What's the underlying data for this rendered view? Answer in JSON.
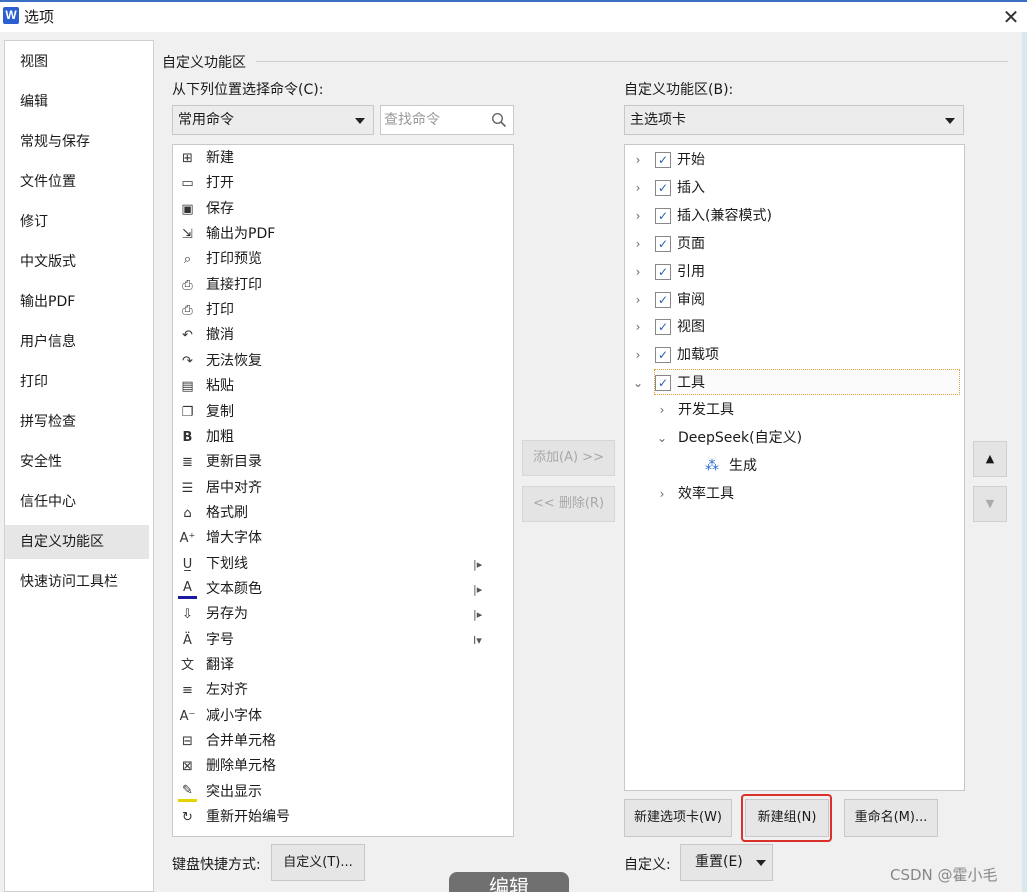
{
  "window": {
    "logo": "W",
    "title": "选项",
    "close": "✕"
  },
  "nav": {
    "items": [
      "视图",
      "编辑",
      "常规与保存",
      "文件位置",
      "修订",
      "中文版式",
      "输出PDF",
      "用户信息",
      "打印",
      "拼写检查",
      "安全性",
      "信任中心",
      "自定义功能区",
      "快速访问工具栏"
    ],
    "active_index": 12
  },
  "section_title": "自定义功能区",
  "left": {
    "label": "从下列位置选择命令(C):",
    "combo_value": "常用命令",
    "search_placeholder": "查找命令",
    "commands": [
      {
        "icon": "new-icon",
        "label": "新建"
      },
      {
        "icon": "open-icon",
        "label": "打开"
      },
      {
        "icon": "save-icon",
        "label": "保存"
      },
      {
        "icon": "export-pdf-icon",
        "label": "输出为PDF"
      },
      {
        "icon": "print-preview-icon",
        "label": "打印预览"
      },
      {
        "icon": "direct-print-icon",
        "label": "直接打印"
      },
      {
        "icon": "print-icon",
        "label": "打印"
      },
      {
        "icon": "undo-icon",
        "label": "撤消"
      },
      {
        "icon": "redo-icon",
        "label": "无法恢复"
      },
      {
        "icon": "paste-icon",
        "label": "粘贴"
      },
      {
        "icon": "copy-icon",
        "label": "复制"
      },
      {
        "icon": "bold-icon",
        "label": "加粗"
      },
      {
        "icon": "update-toc-icon",
        "label": "更新目录"
      },
      {
        "icon": "align-center-icon",
        "label": "居中对齐"
      },
      {
        "icon": "format-painter-icon",
        "label": "格式刷"
      },
      {
        "icon": "increase-font-icon",
        "label": "增大字体"
      },
      {
        "icon": "underline-icon",
        "label": "下划线",
        "sub": "|▸"
      },
      {
        "icon": "font-color-icon",
        "label": "文本颜色",
        "sub": "|▸"
      },
      {
        "icon": "save-as-icon",
        "label": "另存为",
        "sub": "|▸"
      },
      {
        "icon": "font-size-icon",
        "label": "字号",
        "sub": "I▾"
      },
      {
        "icon": "translate-icon",
        "label": "翻译"
      },
      {
        "icon": "align-left-icon",
        "label": "左对齐"
      },
      {
        "icon": "decrease-font-icon",
        "label": "减小字体"
      },
      {
        "icon": "merge-cells-icon",
        "label": "合并单元格"
      },
      {
        "icon": "delete-cells-icon",
        "label": "删除单元格"
      },
      {
        "icon": "highlight-icon",
        "label": "突出显示"
      },
      {
        "icon": "restart-numbering-icon",
        "label": "重新开始编号"
      }
    ],
    "shortcut_label": "键盘快捷方式:",
    "shortcut_button": "自定义(T)..."
  },
  "middle": {
    "add_button": "添加(A) >>",
    "remove_button": "<< 删除(R)"
  },
  "right": {
    "label": "自定义功能区(B):",
    "combo_value": "主选项卡",
    "tabs": [
      {
        "label": "开始",
        "checked": true
      },
      {
        "label": "插入",
        "checked": true
      },
      {
        "label": "插入(兼容模式)",
        "checked": true
      },
      {
        "label": "页面",
        "checked": true
      },
      {
        "label": "引用",
        "checked": true
      },
      {
        "label": "审阅",
        "checked": true
      },
      {
        "label": "视图",
        "checked": true
      },
      {
        "label": "加载项",
        "checked": true
      },
      {
        "label": "工具",
        "checked": true
      }
    ],
    "tool_children": [
      "开发工具",
      "DeepSeek(自定义)",
      "效率工具"
    ],
    "deepseek_child": "生成",
    "new_tab_button": "新建选项卡(W)",
    "new_group_button": "新建组(N)",
    "rename_button": "重命名(M)...",
    "custom_label": "自定义:",
    "reset_button": "重置(E)"
  },
  "overlay_text": "编辑",
  "watermark": "CSDN @霍小毛",
  "colors": {
    "accent": "#2b5fd0",
    "highlight_ring": "#d9312a",
    "selection": "#e6e6e6"
  }
}
